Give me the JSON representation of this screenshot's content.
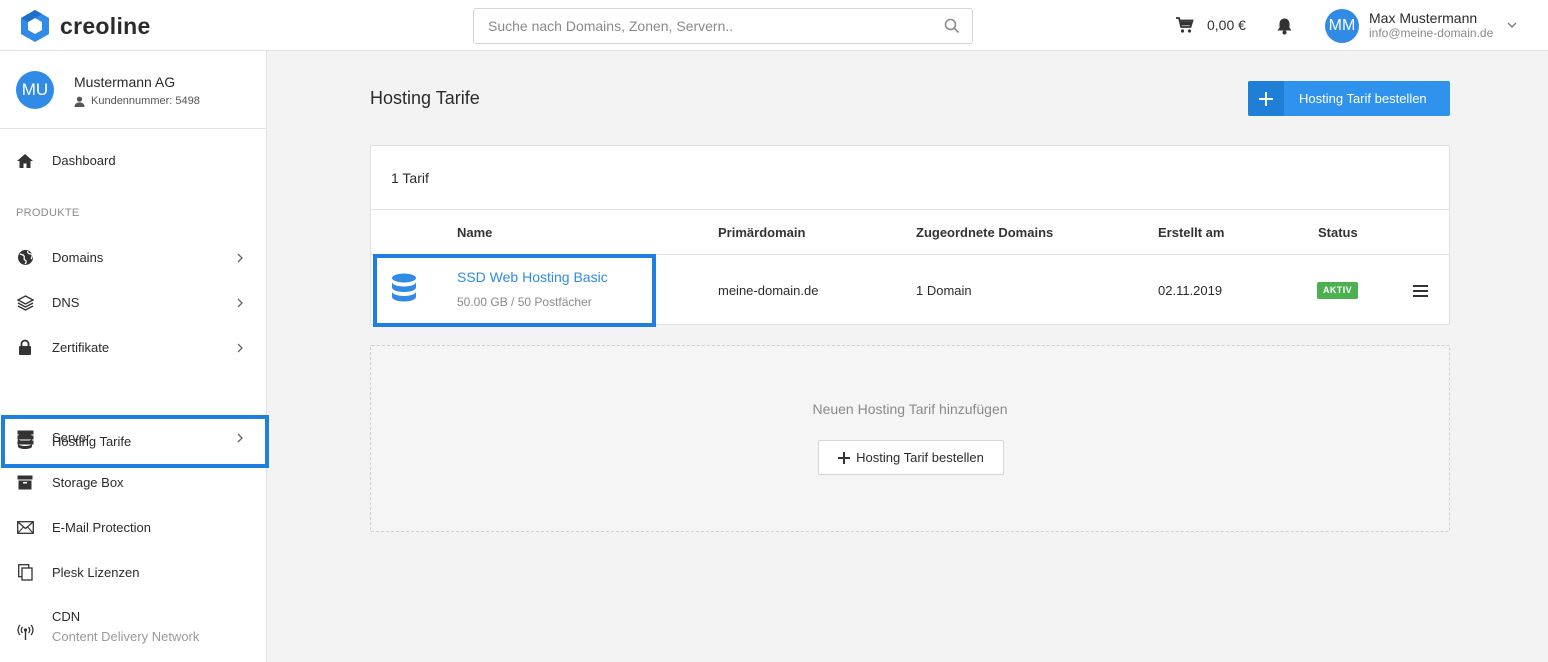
{
  "app": {
    "brand": "creoline",
    "accent": "#2f8be6"
  },
  "header": {
    "search_placeholder": "Suche nach Domains, Zonen, Servern..",
    "cart_amount": "0,00 €",
    "user": {
      "initials": "MM",
      "name": "Max Mustermann",
      "email": "info@meine-domain.de"
    }
  },
  "account": {
    "initials": "MU",
    "name": "Mustermann AG",
    "customer_number": "Kundennummer: 5498"
  },
  "sidebar": {
    "dashboard": "Dashboard",
    "section_products": "PRODUKTE",
    "items": [
      {
        "label": "Domains",
        "icon": "globe-icon",
        "has_children": true
      },
      {
        "label": "DNS",
        "icon": "layers-icon",
        "has_children": true
      },
      {
        "label": "Zertifikate",
        "icon": "lock-icon",
        "has_children": true
      },
      {
        "label": "Hosting Tarife",
        "icon": "database-icon",
        "has_children": false,
        "active": true
      },
      {
        "label": "Server",
        "icon": "server-icon",
        "has_children": true
      },
      {
        "label": "Storage Box",
        "icon": "archive-icon",
        "has_children": false
      },
      {
        "label": "E-Mail Protection",
        "icon": "envelope-icon",
        "has_children": false
      },
      {
        "label": "Plesk Lizenzen",
        "icon": "copy-icon",
        "has_children": false
      },
      {
        "label": "CDN",
        "sub": "Content Delivery Network",
        "icon": "broadcast-icon",
        "has_children": false
      }
    ]
  },
  "main": {
    "title": "Hosting Tarife",
    "order_button": "Hosting Tarif bestellen",
    "count_label": "1 Tarif",
    "columns": [
      "Name",
      "Primärdomain",
      "Zugeordnete Domains",
      "Erstellt am",
      "Status"
    ],
    "rows": [
      {
        "name": "SSD Web Hosting Basic",
        "details": "50.00 GB / 50 Postfächer",
        "primary_domain": "meine-domain.de",
        "assigned_domains": "1 Domain",
        "created": "02.11.2019",
        "status": "AKTIV",
        "status_color": "#4caf50"
      }
    ],
    "add_text": "Neuen Hosting Tarif hinzufügen",
    "add_button": "Hosting Tarif bestellen"
  }
}
